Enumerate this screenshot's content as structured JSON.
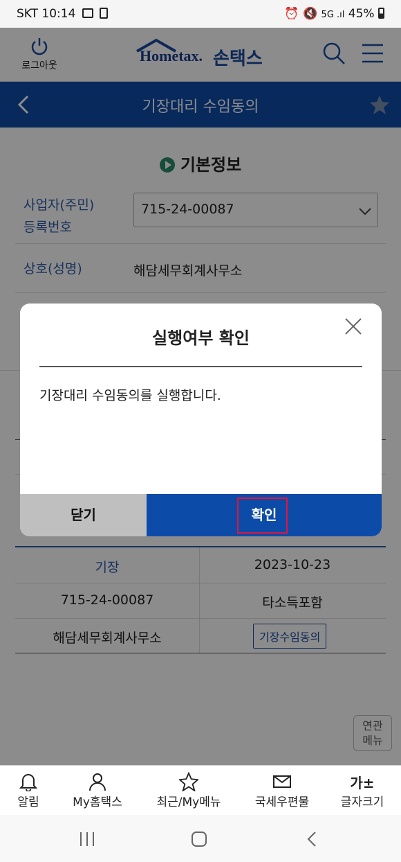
{
  "status_bar": {
    "carrier": "SKT",
    "time": "10:14",
    "battery": "45%"
  },
  "header": {
    "logout_label": "로그아웃",
    "logo_en": "Hometax.",
    "logo_ko": "손택스"
  },
  "title_bar": {
    "title": "기장대리 수임동의"
  },
  "section": {
    "title": "기본정보"
  },
  "form": {
    "biz_label": "사업자(주민)\n등록번호",
    "biz_value": "715-24-00087",
    "name_label": "상호(성명)",
    "name_value": "해담세무회계사무소"
  },
  "table": {
    "rows": [
      {
        "left": "기장",
        "right": "2023-10-23"
      },
      {
        "left": "715-24-00087",
        "right": "타소득포함"
      },
      {
        "left": "해담세무회계사무소",
        "right": "기장수임동의"
      }
    ]
  },
  "related_menu": {
    "label_1": "연관",
    "label_2": "메뉴"
  },
  "dialog": {
    "title": "실행여부 확인",
    "message": "기장대리 수임동의를 실행합니다.",
    "close_label": "닫기",
    "ok_label": "확인"
  },
  "tabbar": {
    "items": [
      {
        "label": "알림",
        "icon": "bell-icon"
      },
      {
        "label": "My홈택스",
        "icon": "person-icon"
      },
      {
        "label": "최근/My메뉴",
        "icon": "star-icon"
      },
      {
        "label": "국세우편물",
        "icon": "mail-icon"
      },
      {
        "label": "글자크기",
        "icon": "font-size-icon",
        "glyph": "가±"
      }
    ]
  },
  "colors": {
    "primary": "#0d4ba8",
    "highlight": "#e0153a",
    "label": "#2c5aa8"
  }
}
